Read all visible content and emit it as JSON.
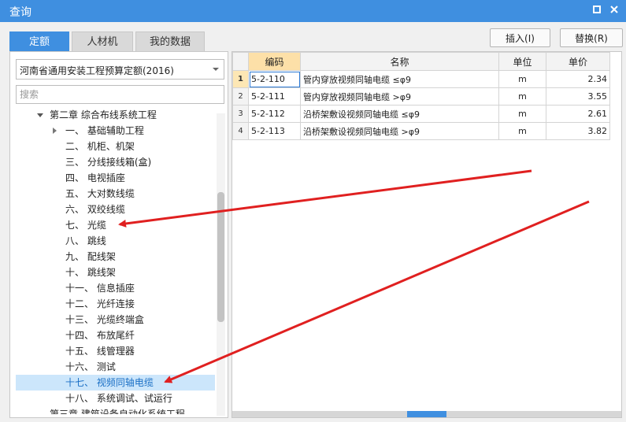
{
  "window": {
    "title": "查询",
    "maximize_icon": "square",
    "close_icon": "x"
  },
  "tabs": [
    {
      "label": "定额",
      "active": true
    },
    {
      "label": "人材机",
      "active": false
    },
    {
      "label": "我的数据",
      "active": false
    }
  ],
  "actions": {
    "insert_label": "插入(I)",
    "replace_label": "替换(R)"
  },
  "library": {
    "selected": "河南省通用安装工程预算定额(2016)"
  },
  "search": {
    "placeholder": "搜索"
  },
  "tree": [
    {
      "label": "第二章 综合布线系统工程",
      "expanded": true
    },
    {
      "label": "一、 基础辅助工程",
      "has_children": true
    },
    {
      "label": "二、 机柜、机架"
    },
    {
      "label": "三、 分线接线箱(盒)"
    },
    {
      "label": "四、 电视插座"
    },
    {
      "label": "五、 大对数线缆"
    },
    {
      "label": "六、 双绞线缆"
    },
    {
      "label": "七、 光缆"
    },
    {
      "label": "八、 跳线"
    },
    {
      "label": "九、 配线架"
    },
    {
      "label": "十、 跳线架"
    },
    {
      "label": "十一、 信息插座"
    },
    {
      "label": "十二、 光纤连接"
    },
    {
      "label": "十三、 光缆终端盒"
    },
    {
      "label": "十四、 布放尾纤"
    },
    {
      "label": "十五、 线管理器"
    },
    {
      "label": "十六、 测试"
    },
    {
      "label": "十七、 视频同轴电缆",
      "selected": true
    },
    {
      "label": "十八、 系统调试、试运行"
    },
    {
      "label": "第三章 建筑设备自动化系统工程"
    }
  ],
  "grid": {
    "columns": [
      "编码",
      "名称",
      "单位",
      "单价"
    ],
    "rows": [
      {
        "index": "1",
        "code": "5-2-110",
        "name": "管内穿放视频同轴电缆 ≤φ9",
        "unit": "m",
        "price": "2.34"
      },
      {
        "index": "2",
        "code": "5-2-111",
        "name": "管内穿放视频同轴电缆 >φ9",
        "unit": "m",
        "price": "3.55"
      },
      {
        "index": "3",
        "code": "5-2-112",
        "name": "沿桥架敷设视频同轴电缆 ≤φ9",
        "unit": "m",
        "price": "2.61"
      },
      {
        "index": "4",
        "code": "5-2-113",
        "name": "沿桥架敷设视频同轴电缆 >φ9",
        "unit": "m",
        "price": "3.82"
      }
    ]
  },
  "colors": {
    "accent": "#3f8fe0",
    "selection": "#cce6fb",
    "annotation_arrow": "#e02020"
  }
}
